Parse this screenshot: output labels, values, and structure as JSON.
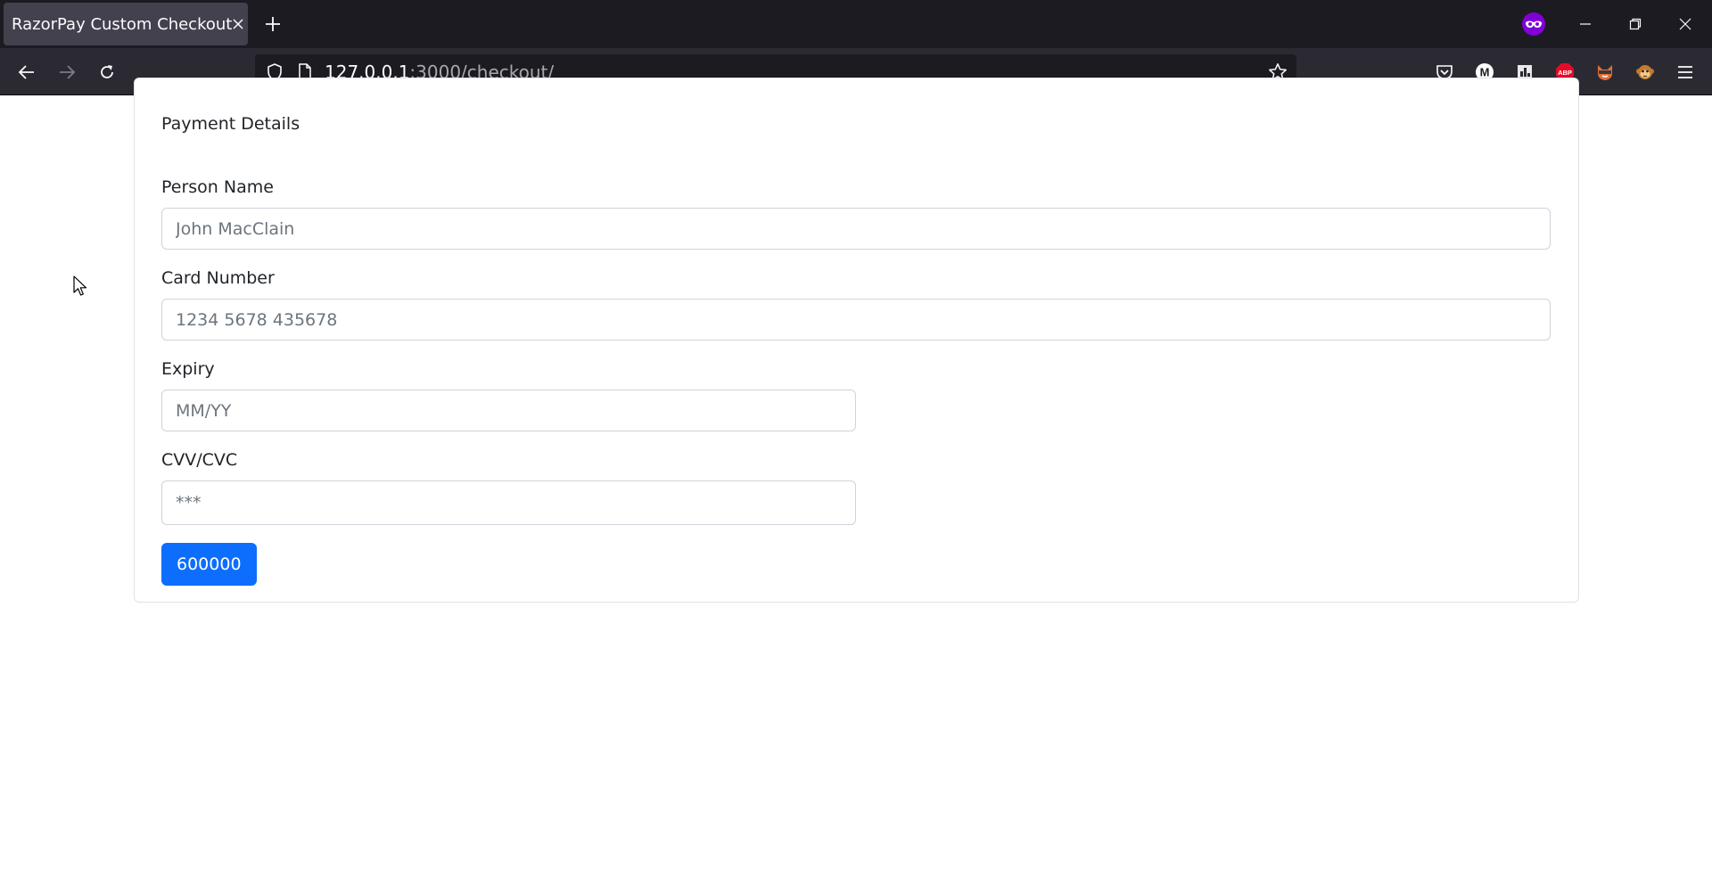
{
  "browser": {
    "tab_title": "RazorPay Custom Checkout",
    "url_host": "127.0.0.1",
    "url_rest": ":3000/checkout/",
    "icons": {
      "tab_close": "close-icon",
      "new_tab": "plus-icon",
      "private_browsing": "private-mask-icon",
      "back": "back-arrow-icon",
      "forward": "forward-arrow-icon",
      "reload": "reload-icon",
      "shield": "shield-icon",
      "page": "page-icon",
      "bookmark": "star-icon",
      "extensions": [
        "pocket-icon",
        "m-extension-icon",
        "box-extension-icon",
        "abp-icon",
        "fox-extension-icon",
        "monkey-extension-icon",
        "hamburger-menu-icon"
      ]
    },
    "extension_labels": {
      "m": "M",
      "abp": "ABP"
    }
  },
  "form": {
    "title": "Payment Details",
    "person_name": {
      "label": "Person Name",
      "placeholder": "John MacClain"
    },
    "card_number": {
      "label": "Card Number",
      "placeholder": "1234 5678 435678"
    },
    "expiry": {
      "label": "Expiry",
      "placeholder": "MM/YY"
    },
    "cvv": {
      "label": "CVV/CVC",
      "placeholder": "***"
    },
    "pay_button_label": "600000"
  },
  "colors": {
    "primary": "#0d6efd",
    "tabbar_bg": "#1c1b22",
    "navbar_bg": "#2b2a33",
    "private_badge": "#8000d7",
    "abp_red": "#e40b26"
  }
}
